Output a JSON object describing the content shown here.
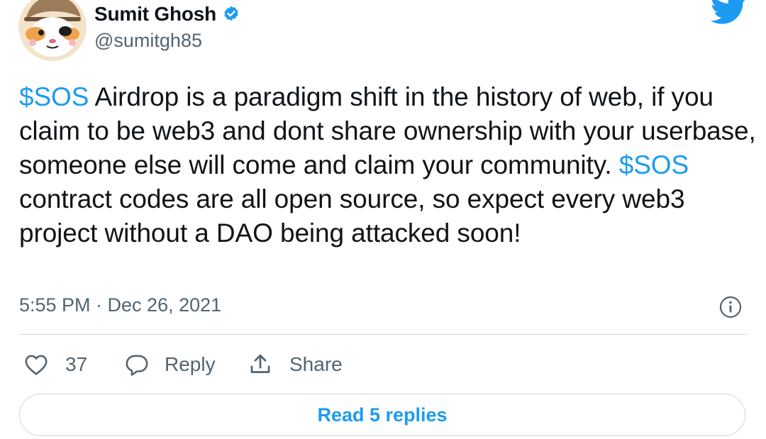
{
  "author": {
    "display_name": "Sumit Ghosh",
    "handle": "@sumitgh85",
    "verified": true,
    "avatar_icon": "cartoon-hamster-avatar"
  },
  "brand": {
    "logo_icon": "twitter-bird-icon",
    "accent_color": "#1d9bf0"
  },
  "tweet": {
    "segments": [
      {
        "text": "$SOS",
        "type": "cashtag"
      },
      {
        "text": " Airdrop is a paradigm shift in the history of web, if you claim to be web3 and dont share ownership with your userbase, someone else will come and claim your community. ",
        "type": "text"
      },
      {
        "text": "$SOS",
        "type": "cashtag"
      },
      {
        "text": " contract codes are all open source, so expect every web3 project without a DAO being attacked soon!",
        "type": "text"
      }
    ],
    "timestamp": "5:55 PM · Dec 26, 2021"
  },
  "actions": {
    "like_count": "37",
    "reply_label": "Reply",
    "share_label": "Share"
  },
  "read_replies_label": "Read 5 replies",
  "colors": {
    "text_primary": "#0f1419",
    "text_secondary": "#536471",
    "divider": "#cfd9de"
  }
}
